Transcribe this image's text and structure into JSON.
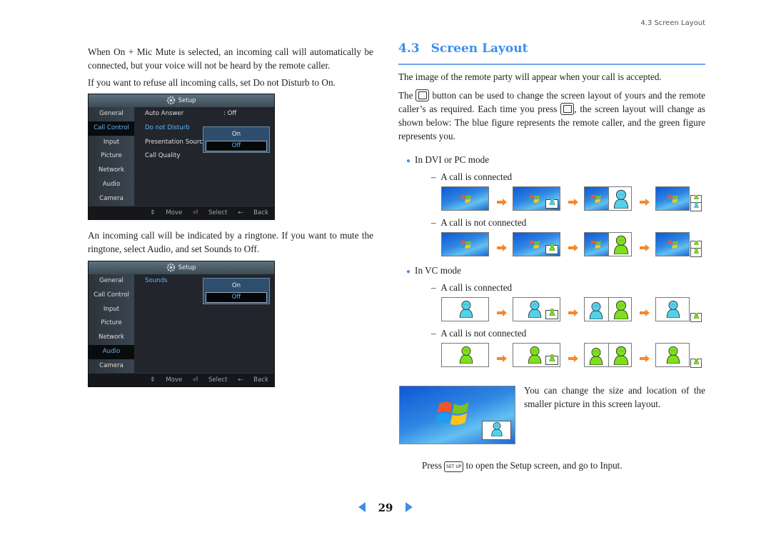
{
  "running_head": "4.3 Screen Layout",
  "left": {
    "para1": "When On + Mic Mute is selected, an incoming call will automatically be connected, but your voice will not be heard by the remote caller.",
    "para2": "If you want to refuse all incoming calls, set Do not Disturb to On.",
    "para3": "An incoming call will be indicated by a ringtone.  If you want to mute the ringtone, select Audio, and set Sounds to Off."
  },
  "setup_menu_1": {
    "title": "Setup",
    "gear_icon": "gear-icon",
    "sidebar": [
      "General",
      "Call Control",
      "Input",
      "Picture",
      "Network",
      "Audio",
      "Camera"
    ],
    "active_sidebar": "Call Control",
    "rows": [
      {
        "label": "Auto Answer",
        "value": ": Off"
      },
      {
        "label": "Do not Disturb",
        "value": ""
      },
      {
        "label": "Presentation Source",
        "value": ""
      },
      {
        "label": "Call Quality",
        "value": ""
      }
    ],
    "active_row": "Do not Disturb",
    "options": [
      "On",
      "Off"
    ],
    "selected_option": "Off",
    "footer": {
      "move": "Move",
      "select": "Select",
      "back": "Back"
    }
  },
  "setup_menu_2": {
    "title": "Setup",
    "sidebar": [
      "General",
      "Call Control",
      "Input",
      "Picture",
      "Network",
      "Audio",
      "Camera"
    ],
    "active_sidebar": "Audio",
    "rows": [
      {
        "label": "Sounds",
        "value": ""
      }
    ],
    "active_row": "Sounds",
    "options": [
      "On",
      "Off"
    ],
    "selected_option": "Off",
    "footer": {
      "move": "Move",
      "select": "Select",
      "back": "Back"
    }
  },
  "right": {
    "section_number": "4.3",
    "section_title": "Screen Layout",
    "intro": "The image of the remote party will appear when your call is accepted.",
    "para_a1": "The",
    "para_a2": "button can be used to change the screen layout of yours and the remote caller’s as required. Each time you press",
    "para_a3": ", the screen layout will change as shown below: The blue figure represents the remote caller, and the green figure represents you.",
    "layout_button_icon": "pip-layout-icon",
    "modes": [
      {
        "label": "In DVI or PC mode",
        "cases": [
          {
            "label": "A call is connected",
            "background": "windows",
            "figure": "remote-blue"
          },
          {
            "label": "A call is not connected",
            "background": "windows",
            "figure": "self-green"
          }
        ]
      },
      {
        "label": "In VC mode",
        "cases": [
          {
            "label": "A call is connected",
            "background": "remote-blue",
            "figure": "self-green"
          },
          {
            "label": "A call is not connected",
            "background": "self-green",
            "figure": "self-green"
          }
        ]
      }
    ],
    "pip_note": "You can change the size and location of the smaller picture in this screen layout.",
    "press_pre": "Press",
    "setup_key": "SET UP",
    "press_post": "to open the Setup screen, and go to Input."
  },
  "colors": {
    "accent": "#3b8ef0",
    "remote_figure": "#52d2ea",
    "self_figure": "#7ee01a",
    "arrow": "#f7862a"
  },
  "page_number": "29"
}
